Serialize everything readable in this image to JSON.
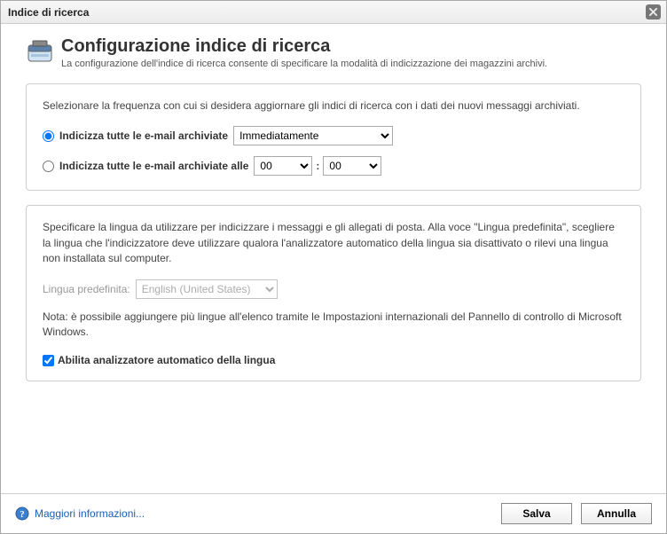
{
  "window": {
    "title": "Indice di ricerca"
  },
  "header": {
    "title": "Configurazione indice di ricerca",
    "subtitle": "La configurazione dell'indice di ricerca consente di specificare la modalità di indicizzazione dei magazzini archivi."
  },
  "frequency_panel": {
    "intro": "Selezionare la frequenza con cui si desidera aggiornare gli indici di ricerca con i dati dei nuovi messaggi archiviati.",
    "option_immediate": {
      "label": "Indicizza tutte le e-mail archiviate",
      "selected_value": "Immediatamente"
    },
    "option_at_time": {
      "label": "Indicizza tutte le e-mail archiviate alle",
      "hour": "00",
      "minute": "00"
    }
  },
  "language_panel": {
    "intro": "Specificare la lingua da utilizzare per indicizzare i messaggi e gli allegati di posta. Alla voce \"Lingua predefinita\", scegliere la lingua che l'indicizzatore deve utilizzare qualora l'analizzatore automatico della lingua sia disattivato o rilevi una lingua non installata sul computer.",
    "default_lang_label": "Lingua predefinita:",
    "default_lang_value": "English (United States)",
    "note": "Nota: è possibile aggiungere più lingue all'elenco tramite le Impostazioni internazionali del Pannello di controllo di Microsoft Windows.",
    "auto_detect_label": "Abilita analizzatore automatico della lingua"
  },
  "footer": {
    "help_label": "Maggiori informazioni...",
    "save_label": "Salva",
    "cancel_label": "Annulla"
  }
}
